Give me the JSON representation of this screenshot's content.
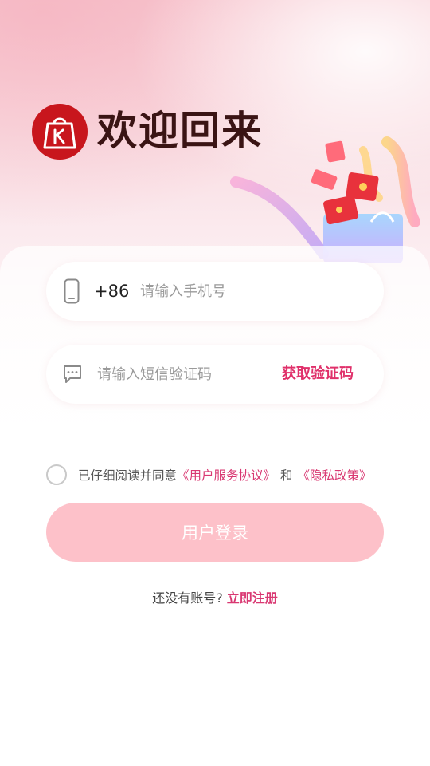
{
  "header": {
    "welcome_title": "欢迎回来"
  },
  "phone_field": {
    "country_code": "+86",
    "placeholder": "请输入手机号",
    "value": ""
  },
  "sms_field": {
    "placeholder": "请输入短信验证码",
    "value": "",
    "get_code_label": "获取验证码"
  },
  "agreement": {
    "checked": false,
    "prefix": "已仔细阅读并同意",
    "user_agreement": "《用户服务协议》",
    "and": "和",
    "privacy_policy": "《隐私政策》"
  },
  "login_button": {
    "label": "用户登录"
  },
  "register": {
    "question": "还没有账号?",
    "link": "立即注册"
  },
  "colors": {
    "brand_red": "#c8161d",
    "accent_pink": "#e0306a",
    "button_disabled": "#fdc1c9"
  },
  "icons": {
    "logo": "shopping-bag-logo",
    "phone": "phone-icon",
    "sms": "chat-bubble-icon",
    "hero": "gift-box-illustration"
  }
}
